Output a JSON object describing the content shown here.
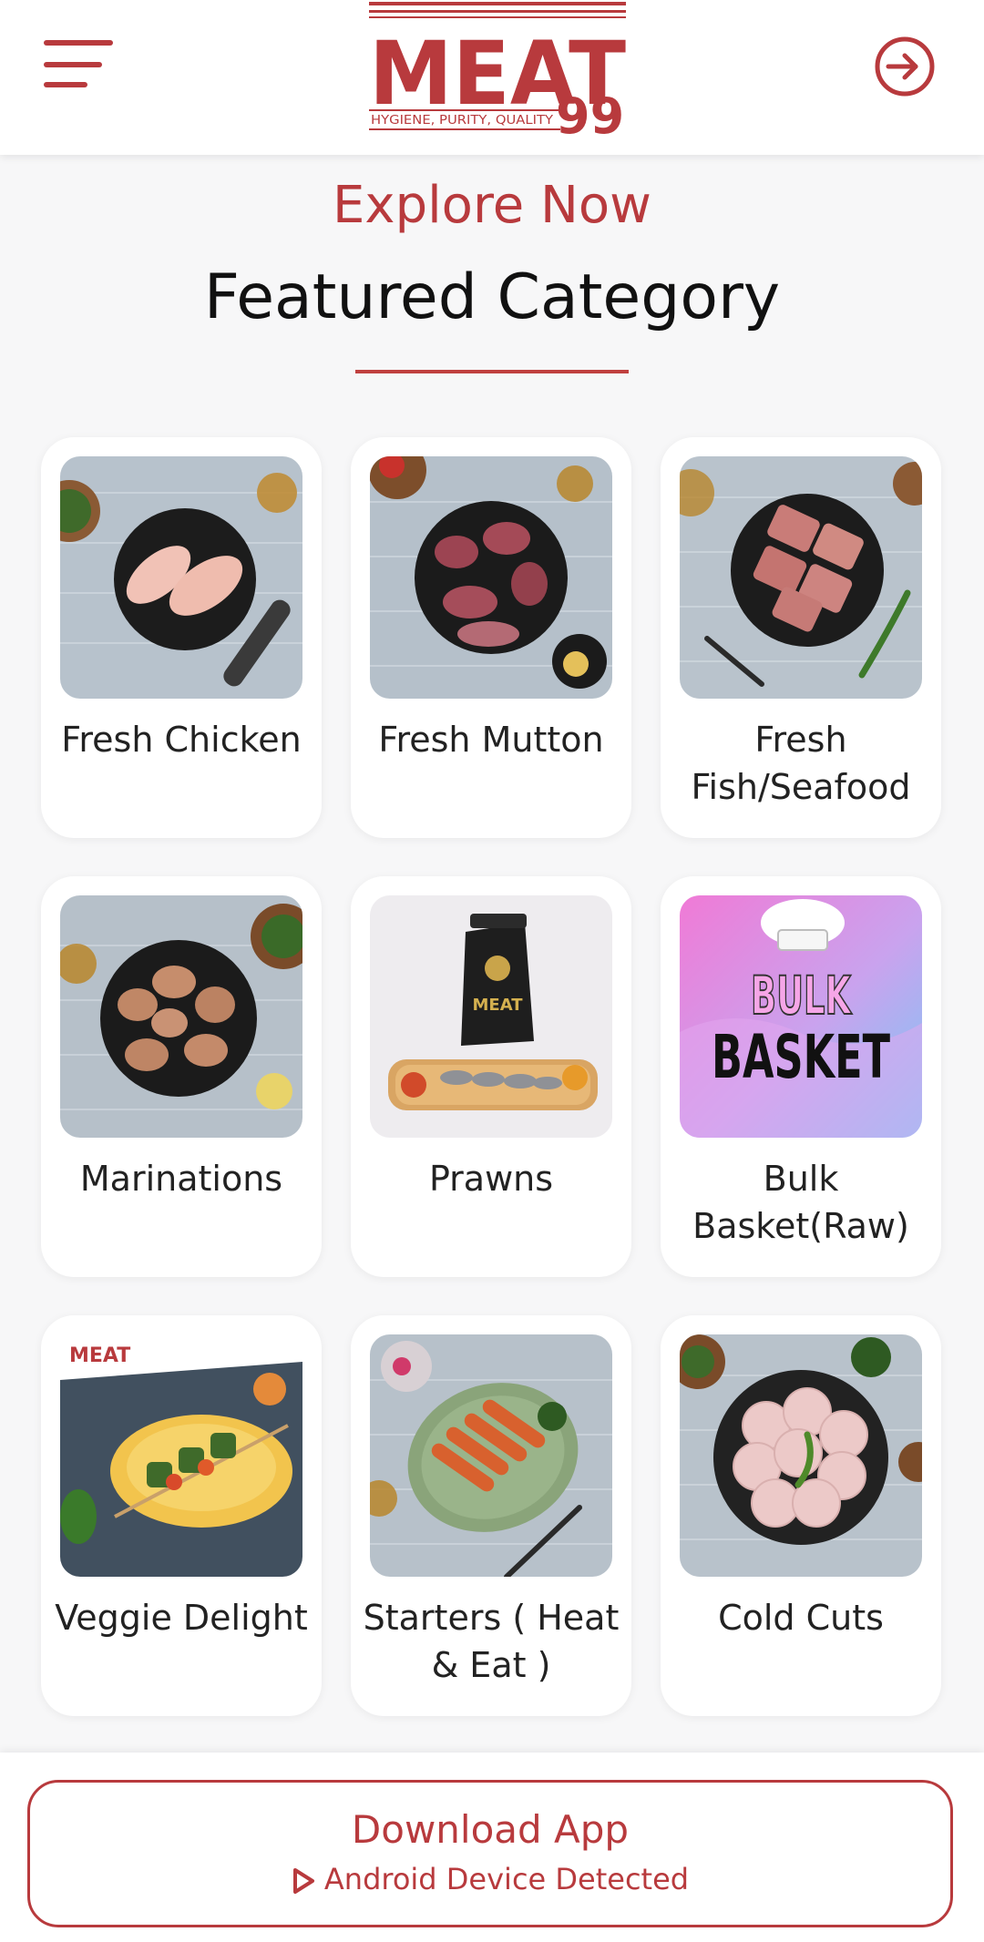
{
  "header": {
    "logo_text": "MEAT",
    "logo_number": "99",
    "logo_tagline": "HYGIENE, PURITY, QUALITY",
    "menu_icon": "hamburger-menu-icon",
    "login_icon": "sign-in-icon"
  },
  "section": {
    "kicker": "Explore Now",
    "title": "Featured Category"
  },
  "categories": [
    {
      "label": "Fresh Chicken",
      "image": "chicken-breast-plate"
    },
    {
      "label": "Fresh Mutton",
      "image": "mutton-pieces-plate"
    },
    {
      "label": "Fresh Fish/Seafood",
      "image": "fish-steaks-plate"
    },
    {
      "label": "Marinations",
      "image": "marinated-chicken-plate"
    },
    {
      "label": "Prawns",
      "image": "prawns-tray-and-pack"
    },
    {
      "label": "Bulk Basket(Raw)",
      "image": "bulk-basket-banner",
      "banner_line1": "BULK",
      "banner_line2": "BASKET"
    },
    {
      "label": "Veggie Delight",
      "image": "veg-skewers-plate"
    },
    {
      "label": "Starters ( Heat & Eat )",
      "image": "kebab-starters-plate"
    },
    {
      "label": "Cold Cuts",
      "image": "cold-cuts-plate"
    }
  ],
  "download": {
    "title": "Download App",
    "subtitle": "Android Device Detected",
    "icon": "play-triangle-icon"
  },
  "colors": {
    "brand": "#b83a3d",
    "background": "#f7f7f8",
    "card": "#ffffff"
  }
}
